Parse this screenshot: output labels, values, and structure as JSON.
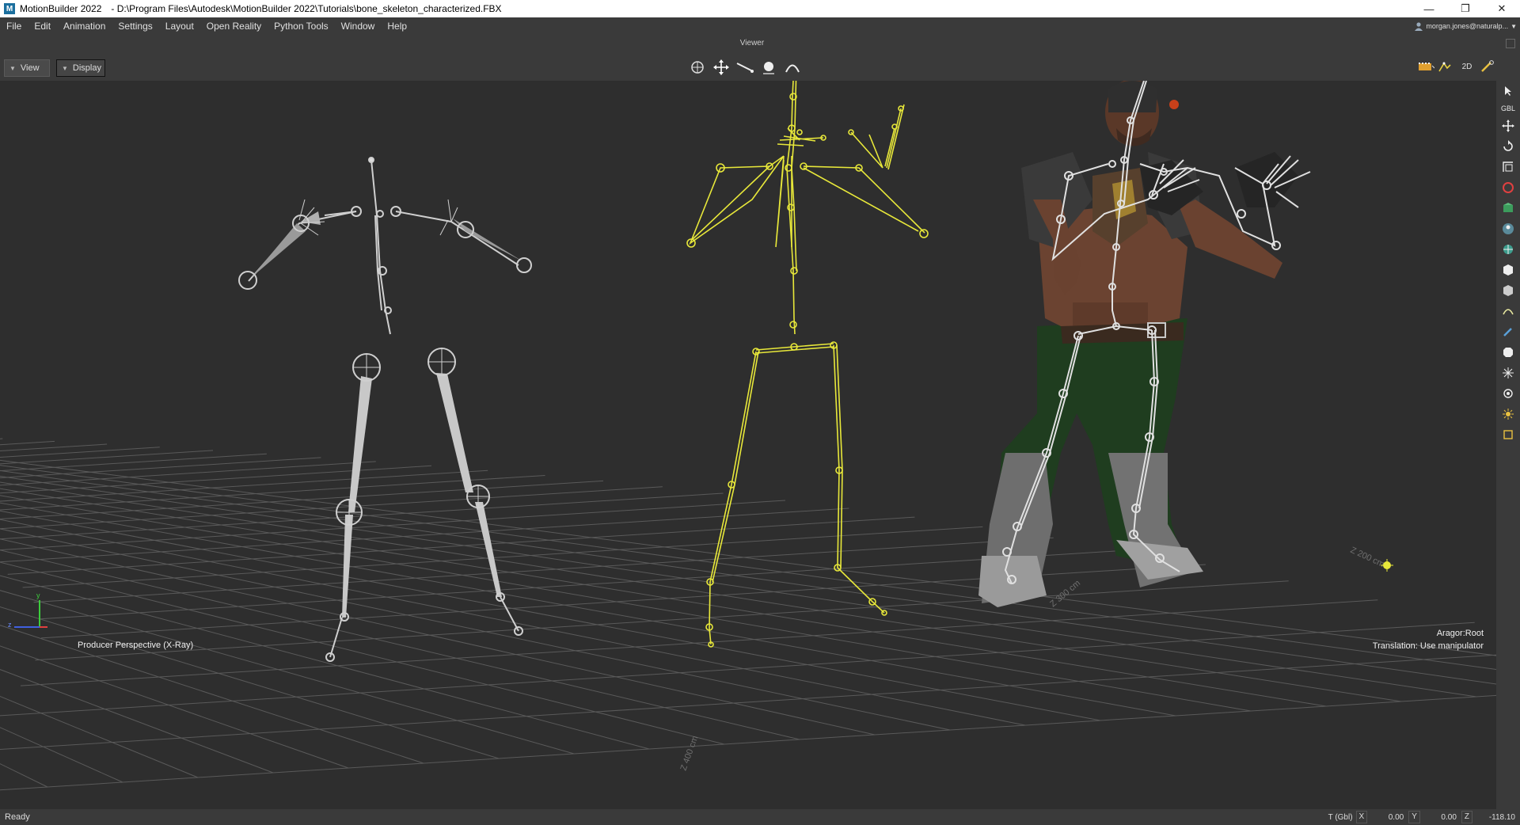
{
  "window": {
    "app_name": "MotionBuilder 2022",
    "file_path": "- D:\\Program Files\\Autodesk\\MotionBuilder 2022\\Tutorials\\bone_skeleton_characterized.FBX",
    "app_icon_letter": "M",
    "minimize": "—",
    "restore": "❐",
    "close": "✕"
  },
  "menu": {
    "items": [
      "File",
      "Edit",
      "Animation",
      "Settings",
      "Layout",
      "Open Reality",
      "Python Tools",
      "Window",
      "Help"
    ],
    "user": "morgan.jones@naturalp..."
  },
  "viewer": {
    "title": "Viewer",
    "view_button": "View",
    "display_button": "Display",
    "mode_2d": "2D"
  },
  "viewport": {
    "camera_label": "Producer Perspective (X-Ray)",
    "selection": "Aragor:Root",
    "hint": "Translation: Use manipulator",
    "grid_labels": [
      "Z 400 cm",
      "Z 300 cm",
      "Z 200 cm"
    ],
    "axis": {
      "y": "y",
      "z": "z"
    },
    "colors": {
      "background": "#2e2e2e",
      "grid": "#5a5a5a",
      "bone_skeleton": "#c8c8c8",
      "selected_skeleton": "#e8e83a"
    }
  },
  "right_toolbar": {
    "gbl_label": "GBL"
  },
  "status": {
    "ready": "Ready",
    "coord_mode": "T (Gbl)",
    "x_label": "X",
    "x_value": "0.00",
    "y_label": "Y",
    "y_value": "0.00",
    "z_label": "Z",
    "z_value": "-118.10"
  }
}
